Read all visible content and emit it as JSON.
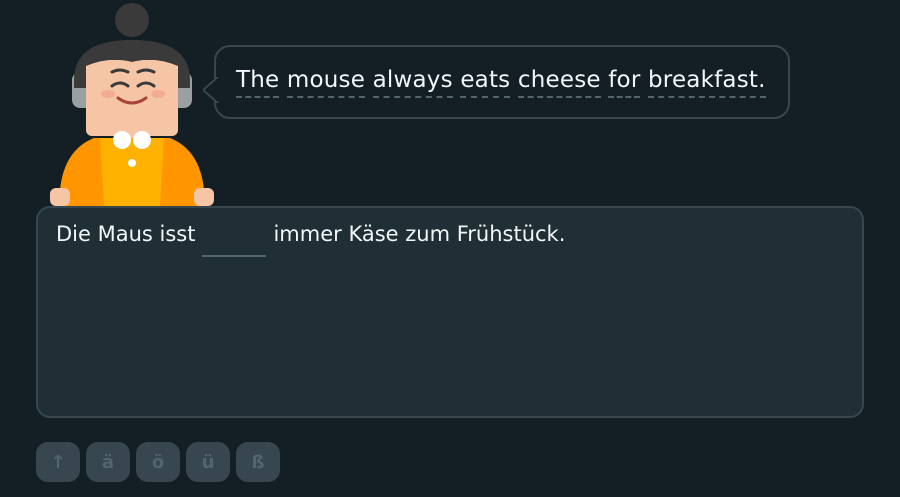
{
  "prompt": {
    "sentence_words": [
      "The",
      "mouse",
      "always",
      "eats",
      "cheese",
      "for",
      "breakfast."
    ]
  },
  "exercise": {
    "before_blank": "Die Maus isst",
    "blank_value": "",
    "after_blank": "immer Käse zum Frühstück."
  },
  "keyboard": {
    "shift_label": "↑",
    "keys": [
      "ä",
      "ö",
      "ü",
      "ß"
    ]
  },
  "colors": {
    "background": "#131f24",
    "panel": "#202f36",
    "border": "#37464f",
    "text": "#f1f7fb",
    "key_text": "#52656d",
    "character_shirt": "#ff9600"
  },
  "character": {
    "icon": "lily-character-avatar"
  }
}
